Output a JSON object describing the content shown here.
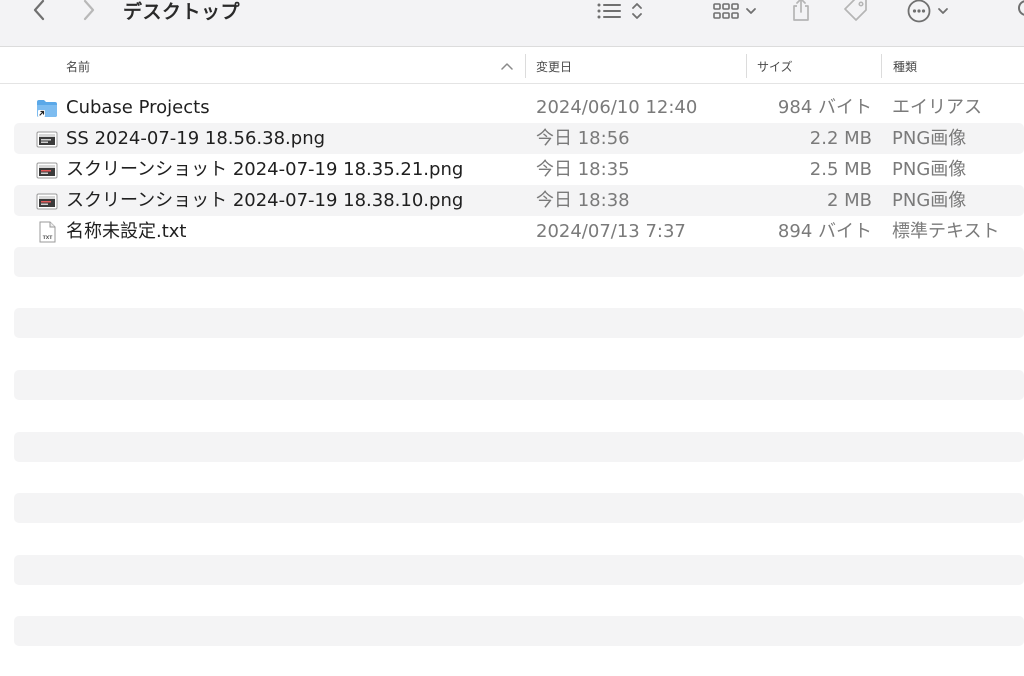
{
  "toolbar": {
    "title": "デスクトップ",
    "icons": {
      "back": "chevron-left-icon",
      "forward": "chevron-right-icon",
      "list_view": "list-view-icon",
      "grid_view": "grid-view-icon",
      "share": "share-icon",
      "tag": "tag-icon",
      "more": "ellipsis-circle-icon",
      "search": "search-icon"
    }
  },
  "columns": {
    "name": "名前",
    "date": "変更日",
    "size": "サイズ",
    "kind": "種類"
  },
  "files": [
    {
      "name": "Cubase Projects",
      "date": "2024/06/10 12:40",
      "size": "984 バイト",
      "kind": "エイリアス",
      "icon": "folder-alias-icon"
    },
    {
      "name": "SS 2024-07-19 18.56.38.png",
      "date": "今日 18:56",
      "size": "2.2 MB",
      "kind": "PNG画像",
      "icon": "image-file-icon"
    },
    {
      "name": "スクリーンショット 2024-07-19 18.35.21.png",
      "date": "今日 18:35",
      "size": "2.5 MB",
      "kind": "PNG画像",
      "icon": "image-file-icon"
    },
    {
      "name": "スクリーンショット 2024-07-19 18.38.10.png",
      "date": "今日 18:38",
      "size": "2 MB",
      "kind": "PNG画像",
      "icon": "image-file-icon"
    },
    {
      "name": "名称未設定.txt",
      "date": "2024/07/13 7:37",
      "size": "894 バイト",
      "kind": "標準テキスト",
      "icon": "text-file-icon",
      "icon_label": "TXT"
    }
  ],
  "colors": {
    "toolbar_bg": "#f3f3f5",
    "stripe_bg": "#f4f4f5",
    "folder_blue": "#5aa8e8",
    "text_primary": "#1f1f1f",
    "text_secondary": "#7a7a7a"
  }
}
